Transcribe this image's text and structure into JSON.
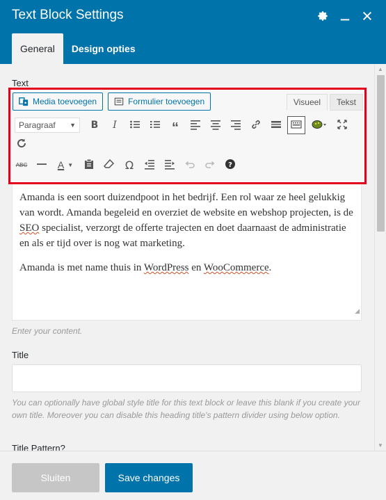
{
  "window": {
    "title": "Text Block Settings"
  },
  "tabs": [
    {
      "label": "General"
    },
    {
      "label": "Design opties"
    }
  ],
  "fields": {
    "text": {
      "label": "Text",
      "help": "Enter your content."
    },
    "title": {
      "label": "Title",
      "value": "",
      "help": "You can optionally have global style title for this text block or leave this blank if you create your own title. Moreover you can disable this heading title's pattern divider using below option."
    },
    "title_pattern": {
      "label": "Title Pattern?"
    }
  },
  "editor": {
    "media_button": "Media toevoegen",
    "form_button": "Formulier toevoegen",
    "mode_visual": "Visueel",
    "mode_text": "Tekst",
    "format_select": "Paragraaf",
    "paragraphs": {
      "p1": {
        "a": "Amanda is een soort duizendpoot in het bedrijf. Een rol waar ze heel gelukkig van wordt. Amanda begeleid en overziet de website en webshop projecten, is de ",
        "seo": "SEO",
        "b": " specialist, verzorgt de offerte trajecten en doet daarnaast de administratie en als er tijd over is nog wat marketing."
      },
      "p2": {
        "a": "Amanda is met name thuis in ",
        "wp": "WordPress",
        "b": " en ",
        "woo": "WooCommerce",
        "c": "."
      }
    },
    "toolbar_row1_icons": [
      "bold-icon",
      "italic-icon",
      "bullet-list-icon",
      "numbered-list-icon",
      "blockquote-icon",
      "align-left-icon",
      "align-center-icon",
      "align-right-icon",
      "link-icon",
      "read-more-icon",
      "toolbar-toggle-icon",
      "color-picker-icon",
      "fullscreen-icon",
      "refresh-icon"
    ],
    "toolbar_row2_icons": [
      "strikethrough-icon",
      "horizontal-line-icon",
      "text-color-icon",
      "paste-text-icon",
      "clear-formatting-icon",
      "special-character-icon",
      "outdent-icon",
      "indent-icon",
      "undo-icon",
      "redo-icon",
      "help-icon"
    ],
    "strikethrough_label": "ABC",
    "text_color_label": "A",
    "omega_label": "Ω"
  },
  "footer": {
    "close_label": "Sluiten",
    "save_label": "Save changes"
  },
  "colors": {
    "brand": "#0073aa",
    "highlight_border": "#e2001a",
    "disabled": "#c6c6c6"
  }
}
